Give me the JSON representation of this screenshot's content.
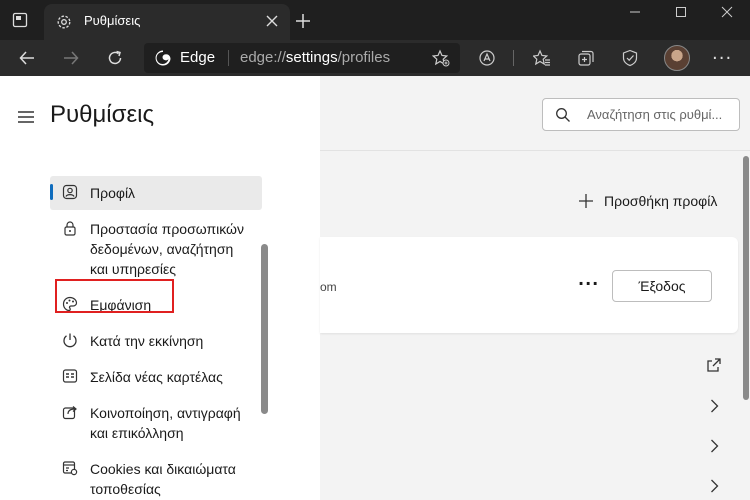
{
  "tab": {
    "title": "Ρυθμίσεις"
  },
  "address": {
    "brand": "Edge",
    "scheme": "edge://",
    "host": "settings",
    "path": "/profiles"
  },
  "settings": {
    "title": "Ρυθμίσεις",
    "nav": [
      {
        "label": "Προφίλ",
        "icon": "profile-icon",
        "active": true
      },
      {
        "label": "Προστασία προσωπικών δεδομένων, αναζήτηση και υπηρεσίες",
        "icon": "lock-icon"
      },
      {
        "label": "Εμφάνιση",
        "icon": "palette-icon"
      },
      {
        "label": "Κατά την εκκίνηση",
        "icon": "power-icon"
      },
      {
        "label": "Σελίδα νέας καρτέλας",
        "icon": "newtab-page-icon"
      },
      {
        "label": "Κοινοποίηση, αντιγραφή και επικόλληση",
        "icon": "share-icon"
      },
      {
        "label": "Cookies και δικαιώματα τοποθεσίας",
        "icon": "cookies-icon"
      }
    ]
  },
  "search": {
    "placeholder": "Αναζήτηση στις ρυθμί..."
  },
  "profile": {
    "add_label": "Προσθήκη προφίλ",
    "email_fragment": "om",
    "more_label": "···",
    "signout_label": "Έξοδος"
  },
  "colors": {
    "accent": "#0f6cbd",
    "highlight": "#e02020"
  }
}
